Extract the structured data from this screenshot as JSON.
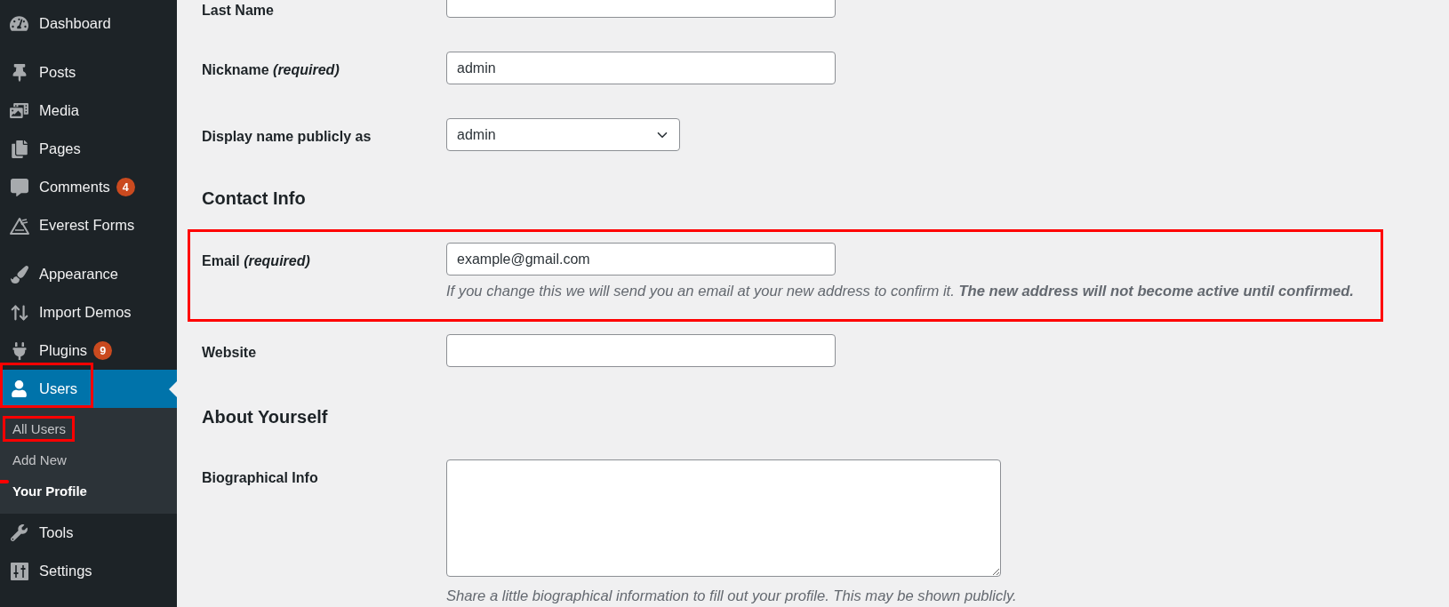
{
  "sidebar": {
    "groups": [
      {
        "items": [
          {
            "label": "Dashboard",
            "selected": false,
            "highlighted": false
          }
        ]
      },
      {
        "items": [
          {
            "label": "Posts",
            "selected": false,
            "highlighted": false
          },
          {
            "label": "Media",
            "selected": false,
            "highlighted": false
          },
          {
            "label": "Pages",
            "selected": false,
            "highlighted": false
          },
          {
            "label": "Comments",
            "badge": "4",
            "selected": false,
            "highlighted": false
          },
          {
            "label": "Everest Forms",
            "selected": false,
            "highlighted": false
          }
        ]
      },
      {
        "items": [
          {
            "label": "Appearance",
            "selected": false,
            "highlighted": false
          },
          {
            "label": "Import Demos",
            "selected": false,
            "highlighted": false
          },
          {
            "label": "Plugins",
            "badge": "9",
            "selected": false,
            "highlighted": false
          },
          {
            "label": "Users",
            "selected": true,
            "highlighted": true,
            "children": [
              {
                "label": "All Users",
                "selected": false,
                "highlighted": true,
                "marked": false
              },
              {
                "label": "Add New",
                "selected": false,
                "highlighted": false,
                "marked": false
              },
              {
                "label": "Your Profile",
                "selected": true,
                "highlighted": false,
                "marked": true
              }
            ]
          },
          {
            "label": "Tools",
            "selected": false,
            "highlighted": false
          },
          {
            "label": "Settings",
            "selected": false,
            "highlighted": false
          }
        ]
      }
    ]
  },
  "form": {
    "sections": [
      {
        "rows": [
          {
            "kind": "text",
            "label": "Last Name",
            "highlighted": false
          },
          {
            "kind": "text",
            "label": "Nickname *(required)*",
            "value": "admin",
            "highlighted": false
          },
          {
            "kind": "select",
            "label": "Display name publicly as",
            "value": "admin",
            "highlighted": false
          }
        ]
      },
      {
        "heading": "Contact Info",
        "rows": [
          {
            "kind": "text",
            "label": "Email *(required)*",
            "value": "example@gmail.com",
            "description": "If you change this we will send you an email at your new address to confirm it. **The new address will not become active until confirmed.**",
            "highlighted": true
          },
          {
            "kind": "text",
            "label": "Website",
            "highlighted": false
          }
        ]
      },
      {
        "heading": "About Yourself",
        "rows": [
          {
            "kind": "textarea",
            "label": "Biographical Info",
            "description": "Share a little biographical information to fill out your profile. This may be shown publicly.",
            "highlighted": false
          }
        ]
      }
    ]
  }
}
